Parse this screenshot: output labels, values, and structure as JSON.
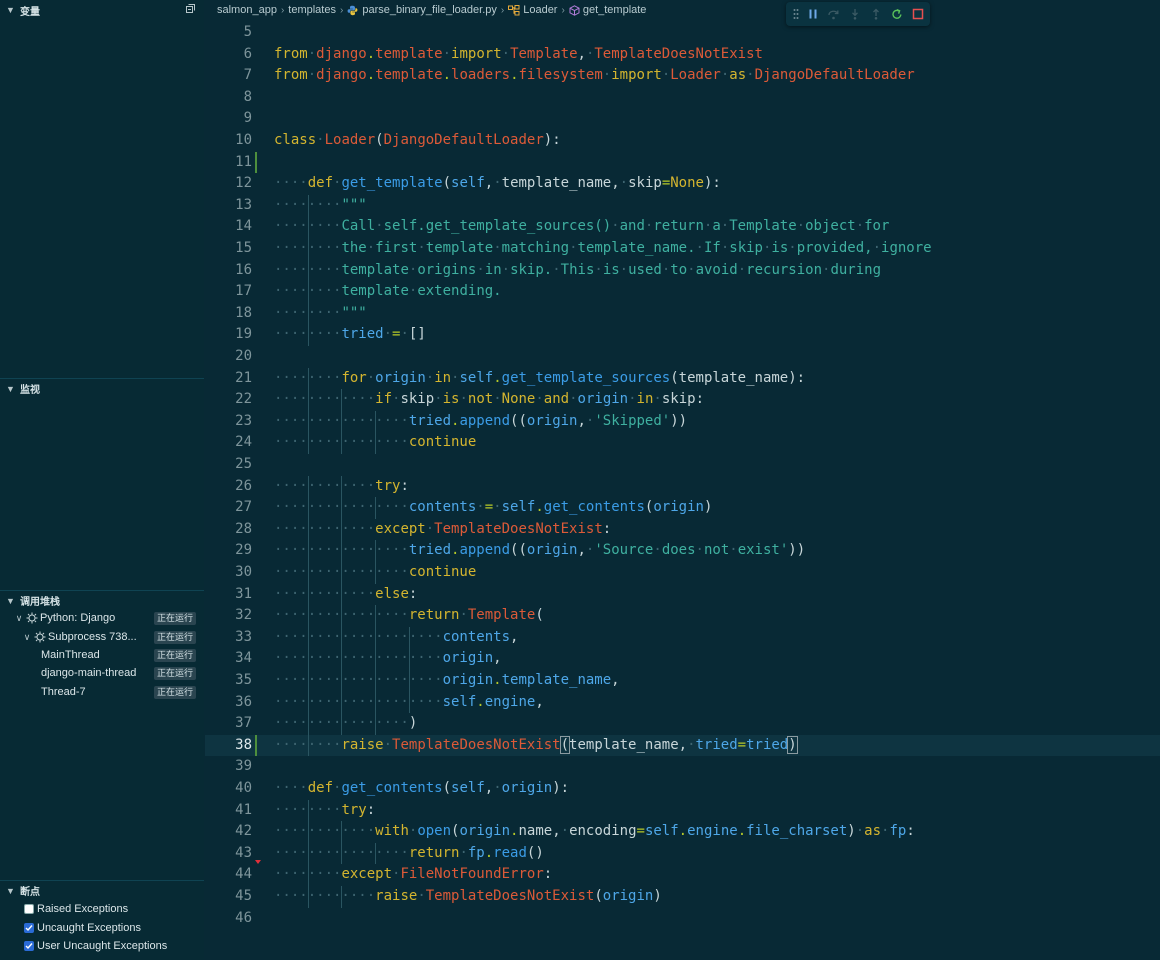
{
  "sidebar": {
    "variables_title": "变量",
    "watch_title": "监视",
    "callstack_title": "调用堆栈",
    "breakpoints_title": "断点",
    "call_stack": [
      {
        "label": "Python: Django",
        "status": "正在运行",
        "level": 0,
        "twisty": "expanded",
        "icon": "gear-icon"
      },
      {
        "label": "Subprocess 738...",
        "status": "正在运行",
        "level": 1,
        "twisty": "expanded",
        "icon": "gear-icon"
      },
      {
        "label": "MainThread",
        "status": "正在运行",
        "level": 2
      },
      {
        "label": "django-main-thread",
        "status": "正在运行",
        "level": 2
      },
      {
        "label": "Thread-7",
        "status": "正在运行",
        "level": 2
      }
    ],
    "breakpoints": [
      {
        "label": "Raised Exceptions",
        "checked": false
      },
      {
        "label": "Uncaught Exceptions",
        "checked": true
      },
      {
        "label": "User Uncaught Exceptions",
        "checked": true
      }
    ]
  },
  "breadcrumb": [
    "salmon_app",
    "templates",
    "parse_binary_file_loader.py",
    "Loader",
    "get_template"
  ],
  "toolbar": {
    "buttons": [
      "drag-handle-icon",
      "pause-icon",
      "step-over-icon",
      "step-into-icon",
      "step-out-icon",
      "restart-icon",
      "stop-icon"
    ]
  },
  "editor": {
    "colors": {
      "keyword": "#d4b52f",
      "class": "#dc5a38",
      "function": "#3b9ce6",
      "string": "#3fb0a0",
      "self": "#4ea7e8"
    },
    "current_line": 38,
    "lines": [
      {
        "n": 5,
        "c": ""
      },
      {
        "n": 6,
        "c": "from django.template import Template, TemplateDoesNotExist"
      },
      {
        "n": 7,
        "c": "from django.template.loaders.filesystem import Loader as DjangoDefaultLoader"
      },
      {
        "n": 8,
        "c": ""
      },
      {
        "n": 9,
        "c": ""
      },
      {
        "n": 10,
        "c": "class Loader(DjangoDefaultLoader):"
      },
      {
        "n": 11,
        "c": ""
      },
      {
        "n": 12,
        "c": "    def get_template(self, template_name, skip=None):"
      },
      {
        "n": 13,
        "c": "        \"\"\""
      },
      {
        "n": 14,
        "c": "        Call self.get_template_sources() and return a Template object for"
      },
      {
        "n": 15,
        "c": "        the first template matching template_name. If skip is provided, ignore"
      },
      {
        "n": 16,
        "c": "        template origins in skip. This is used to avoid recursion during"
      },
      {
        "n": 17,
        "c": "        template extending."
      },
      {
        "n": 18,
        "c": "        \"\"\""
      },
      {
        "n": 19,
        "c": "        tried = []"
      },
      {
        "n": 20,
        "c": ""
      },
      {
        "n": 21,
        "c": "        for origin in self.get_template_sources(template_name):"
      },
      {
        "n": 22,
        "c": "            if skip is not None and origin in skip:"
      },
      {
        "n": 23,
        "c": "                tried.append((origin, 'Skipped'))"
      },
      {
        "n": 24,
        "c": "                continue"
      },
      {
        "n": 25,
        "c": ""
      },
      {
        "n": 26,
        "c": "            try:"
      },
      {
        "n": 27,
        "c": "                contents = self.get_contents(origin)"
      },
      {
        "n": 28,
        "c": "            except TemplateDoesNotExist:"
      },
      {
        "n": 29,
        "c": "                tried.append((origin, 'Source does not exist'))"
      },
      {
        "n": 30,
        "c": "                continue"
      },
      {
        "n": 31,
        "c": "            else:"
      },
      {
        "n": 32,
        "c": "                return Template("
      },
      {
        "n": 33,
        "c": "                    contents,"
      },
      {
        "n": 34,
        "c": "                    origin,"
      },
      {
        "n": 35,
        "c": "                    origin.template_name,"
      },
      {
        "n": 36,
        "c": "                    self.engine,"
      },
      {
        "n": 37,
        "c": "                )"
      },
      {
        "n": 38,
        "c": "        raise TemplateDoesNotExist(template_name, tried=tried)"
      },
      {
        "n": 39,
        "c": ""
      },
      {
        "n": 40,
        "c": "    def get_contents(self, origin):"
      },
      {
        "n": 41,
        "c": "        try:"
      },
      {
        "n": 42,
        "c": "            with open(origin.name, encoding=self.engine.file_charset) as fp:"
      },
      {
        "n": 43,
        "c": "                return fp.read()"
      },
      {
        "n": 44,
        "c": "        except FileNotFoundError:"
      },
      {
        "n": 45,
        "c": "            raise TemplateDoesNotExist(origin)"
      },
      {
        "n": 46,
        "c": ""
      }
    ]
  }
}
